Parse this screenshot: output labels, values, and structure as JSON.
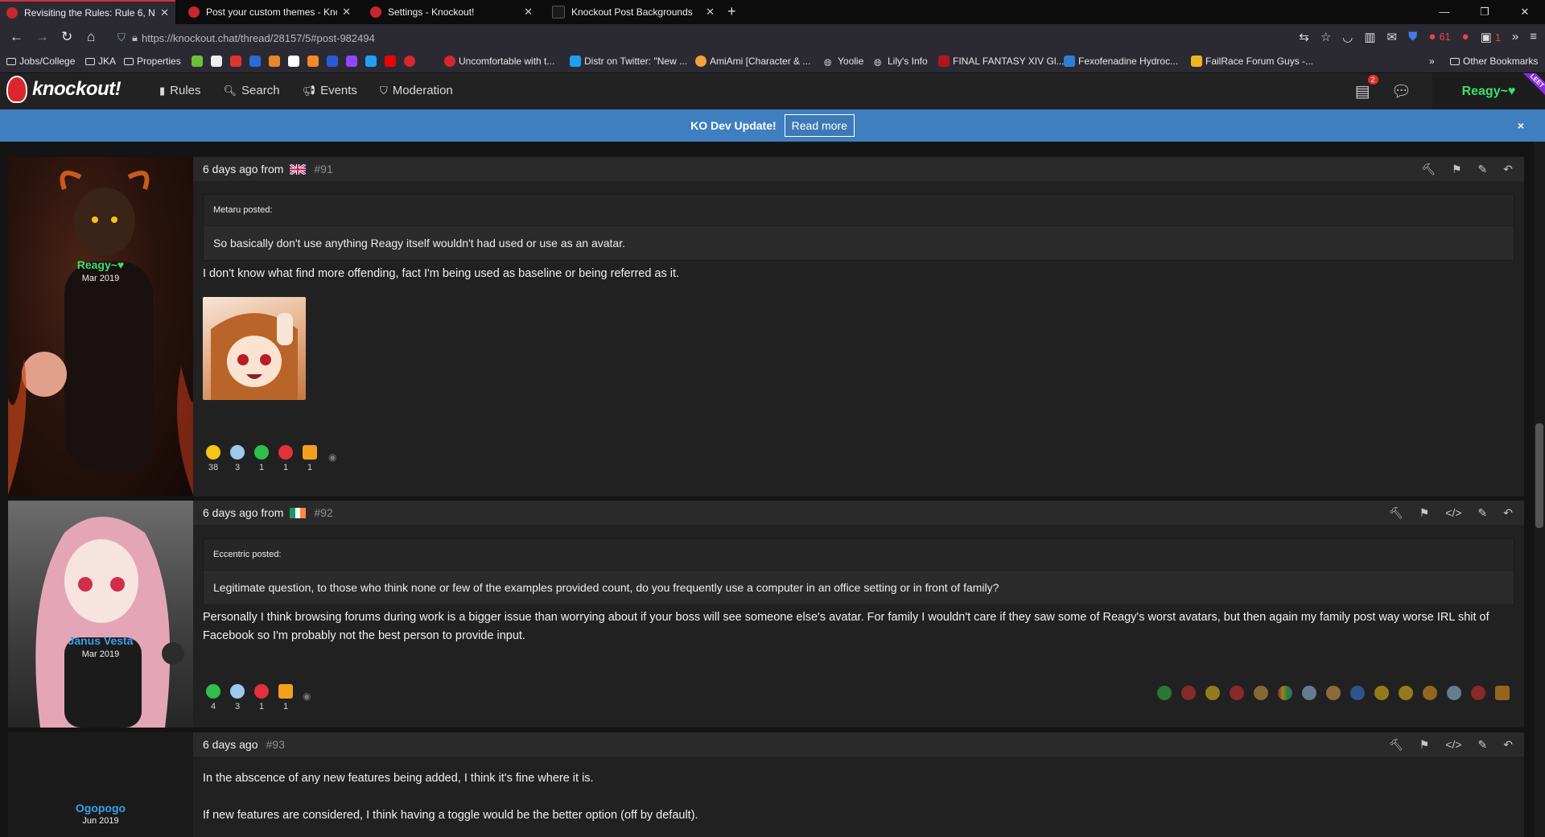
{
  "browser": {
    "tabs": [
      {
        "title": "Revisiting the Rules: Rule 6, No N",
        "active": true
      },
      {
        "title": "Post your custom themes - Knoc"
      },
      {
        "title": "Settings - Knockout!"
      },
      {
        "title": "Knockout Post Backgrounds"
      }
    ],
    "url": "https://knockout.chat/thread/28157/5#post-982494",
    "bookmarks": [
      "Jobs/College",
      "JKA",
      "Properties",
      "Uncomfortable with t...",
      "Distr on Twitter: \"New ...",
      "AmiAmi [Character & ...",
      "Yoolie",
      "Lily's Info",
      "FINAL FANTASY XIV Gl...",
      "Fexofenadine Hydroc...",
      "FailRace Forum Guys -...",
      "Other Bookmarks"
    ],
    "ext_badge_a": "61",
    "ext_badge_b": "1"
  },
  "site": {
    "logo": "knockout!",
    "menu": [
      "Rules",
      "Search",
      "Events",
      "Moderation"
    ],
    "notifications_count": "2",
    "user": "Reagy~♥",
    "ribbon": "LEET",
    "dev_update": {
      "text": "KO Dev Update!",
      "button": "Read more",
      "close": "×"
    }
  },
  "posts": [
    {
      "author": "Reagy~♥",
      "joined": "Mar 2019",
      "author_color": "#3ae06a",
      "time": "6 days ago from",
      "flag": "UK",
      "number": "#91",
      "quote": {
        "author": "Metaru  posted:",
        "text": "So basically don't use anything Reagy itself wouldn't had used or use as an avatar."
      },
      "text": "I don't know what find more offending, fact I'm being used as baseline or being referred as it.",
      "ratings": [
        {
          "icon": "pacman",
          "color": "#f5c518",
          "count": "38"
        },
        {
          "icon": "rain-cloud",
          "color": "#9ec9ee",
          "count": "3"
        },
        {
          "icon": "check",
          "color": "#2fbf4a",
          "count": "1"
        },
        {
          "icon": "heart",
          "color": "#e2313a",
          "count": "1"
        },
        {
          "icon": "box",
          "color": "#f2a01e",
          "count": "1"
        }
      ]
    },
    {
      "author": "Janus Vesta",
      "joined": "Mar 2019",
      "author_color": "#3aa0e8",
      "time": "6 days ago from",
      "flag": "IE",
      "number": "#92",
      "quote": {
        "author": "Eccentric  posted:",
        "text": "Legitimate question, to those who think none or few of the examples provided count, do you frequently use a computer in an office setting or in front of family?"
      },
      "text": "Personally I think browsing forums during work is a bigger issue than worrying about if your boss will see someone else's avatar. For family I wouldn't care if they saw some of Reagy's worst avatars, but then again my family post way worse IRL shit of Facebook so I'm probably not the best person to provide input.",
      "ratings": [
        {
          "icon": "check",
          "color": "#2fbf4a",
          "count": "4"
        },
        {
          "icon": "sunglasses",
          "color": "#9ec9ee",
          "count": "3"
        },
        {
          "icon": "heart",
          "color": "#e2313a",
          "count": "1"
        },
        {
          "icon": "box",
          "color": "#f2a01e",
          "count": "1"
        }
      ]
    },
    {
      "author": "Ogopogo",
      "joined": "Jun 2019",
      "author_color": "#3aa0e8",
      "time": "6 days ago",
      "number": "#93",
      "text1": "In the abscence of any new features being added, I think it's fine where it is.",
      "text2": "If new features are considered, I think having a toggle would be the better option (off by default)."
    }
  ]
}
